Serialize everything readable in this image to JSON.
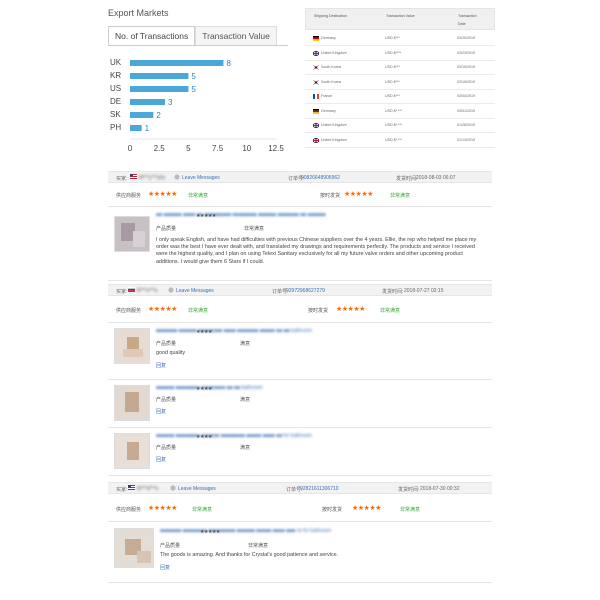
{
  "export_markets": {
    "title": "Export Markets",
    "tabs": [
      {
        "label": "No. of Transactions",
        "active": true
      },
      {
        "label": "Transaction Value",
        "active": false
      }
    ]
  },
  "chart_data": {
    "type": "bar",
    "orientation": "horizontal",
    "categories": [
      "UK",
      "KR",
      "US",
      "DE",
      "SK",
      "PH"
    ],
    "values": [
      8,
      5,
      5,
      3,
      2,
      1
    ],
    "xlim": [
      0,
      12.5
    ],
    "xticks": [
      "0",
      "2.5",
      "5",
      "7.5",
      "10",
      "12.5"
    ],
    "data_labels": true,
    "bar_color": "#4aa8d8",
    "label_color": "#2e86c1"
  },
  "transactions": {
    "headers": {
      "destination": "Shipping Destination",
      "value": "Transaction Value",
      "date_line1": "Transaction",
      "date_line2": "Date"
    },
    "rows": [
      {
        "flag": "germany",
        "destination": "Germany",
        "value": "USD $***",
        "date": "03/20/2019"
      },
      {
        "flag": "uk",
        "destination": "United Kingdom",
        "value": "USD $****",
        "date": "03/23/2019"
      },
      {
        "flag": "south-korea",
        "destination": "South Korea",
        "value": "USD $***",
        "date": "03/19/2019"
      },
      {
        "flag": "south-korea",
        "destination": "South Korea",
        "value": "USD $***",
        "date": "03/19/2019"
      },
      {
        "flag": "france",
        "destination": "France",
        "value": "USD $***",
        "date": "03/04/2019"
      },
      {
        "flag": "germany",
        "destination": "Germany",
        "value": "USD $*,***",
        "date": "03/01/2019"
      },
      {
        "flag": "uk",
        "destination": "United Kingdom",
        "value": "USD $*,***",
        "date": "01/28/2019"
      },
      {
        "flag": "uk",
        "destination": "United Kingdom",
        "value": "USD $*,***",
        "date": "01/14/2019"
      }
    ]
  },
  "orders": [
    {
      "buyer_label": "买家:",
      "buyer_name": "M***y***ylor",
      "leave_messages": "Leave Messages",
      "order_label": "订单号:",
      "order_no": "90826648906962",
      "ship_label": "发货时间:",
      "ship_time": "2018-08-03 06:07",
      "supplier_label": "供应商服务",
      "supplier_verdict": "非常满意",
      "delivery_label": "按时发货",
      "delivery_verdict": "非常满意",
      "reviews": [
        {
          "product": "■■ ■■■■■■ ■■■■ ■■ ■■■■■■■■■ ■■■■■■■■ ■■■■■■ ■■■■■■■ ■■ ■■■■■■",
          "quality_label": "产品质量",
          "quality_verdict": "非常满意",
          "text": "I only speak English, and have had difficulties with previous Chinese suppliers over the 4 years. Ellie, the rep who helped me place my order was the best I have ever dealt with, and translated my drawings and requirements perfectly. The products and service I received were the highest quality, and I plan on using Telexi Sanitary exclusively for all my future valve orders and other upcoming product additions. I would give them 6 Stars if I could.",
          "reply": ""
        }
      ]
    },
    {
      "buyer_label": "买家:",
      "buyer_name": "R***s***e",
      "leave_messages": "Leave Messages",
      "order_label": "订单号:",
      "order_no": "92972968627279",
      "ship_label": "发货时间:",
      "ship_time": "2018-07-27 02:15",
      "supplier_label": "供应商服务",
      "supplier_verdict": "非常满意",
      "delivery_label": "按时发货",
      "delivery_verdict": "非常满意",
      "reviews": [
        {
          "product": "■■■■■■■ ■■■■■■ ■■■■■■■■ ■■■■ ■■■■■■■ ■■■■■ ■■ ■■ bathroom",
          "quality_label": "产品质量",
          "quality_verdict": "满意",
          "text": "good quality",
          "reply": "回复"
        },
        {
          "product": "■■■■■■ ■■■■■■■■ ■■■■■■■■ ■■ ■■ bathroom",
          "quality_label": "产品质量",
          "quality_verdict": "满意",
          "text": "",
          "reply": "回复"
        },
        {
          "product": "■■■■■■ ■■■■■■■■ ■■■■■■ ■■■■■■■■ ■■■■■ ■■■■ ■■ for bathroom",
          "quality_label": "产品质量",
          "quality_verdict": "满意",
          "text": "",
          "reply": "回复"
        }
      ]
    },
    {
      "buyer_label": "买家:",
      "buyer_name": "M***d***e",
      "leave_messages": "Leave Messages",
      "order_label": "订单号:",
      "order_no": "92821611306710",
      "ship_label": "发货时间:",
      "ship_time": "2018-07-30 00:32",
      "supplier_label": "供应商服务",
      "supplier_verdict": "非常满意",
      "delivery_label": "按时发货",
      "delivery_verdict": "非常满意",
      "reviews": [
        {
          "product": "■■■■■■■ ■■■■■■■■ ■■■■■■■■■ ■■■■■■ ■■■■■ ■■■■ ■■■ ck for bathroom",
          "quality_label": "产品质量",
          "quality_verdict": "非常满意",
          "text": "The goods is amazing. And thanks for Crystal's good patience and service.",
          "reply": "回复"
        }
      ]
    }
  ],
  "colors": {
    "star": "#ff6a00",
    "link": "#3a6fb6",
    "verdict": "#3aa63a"
  }
}
